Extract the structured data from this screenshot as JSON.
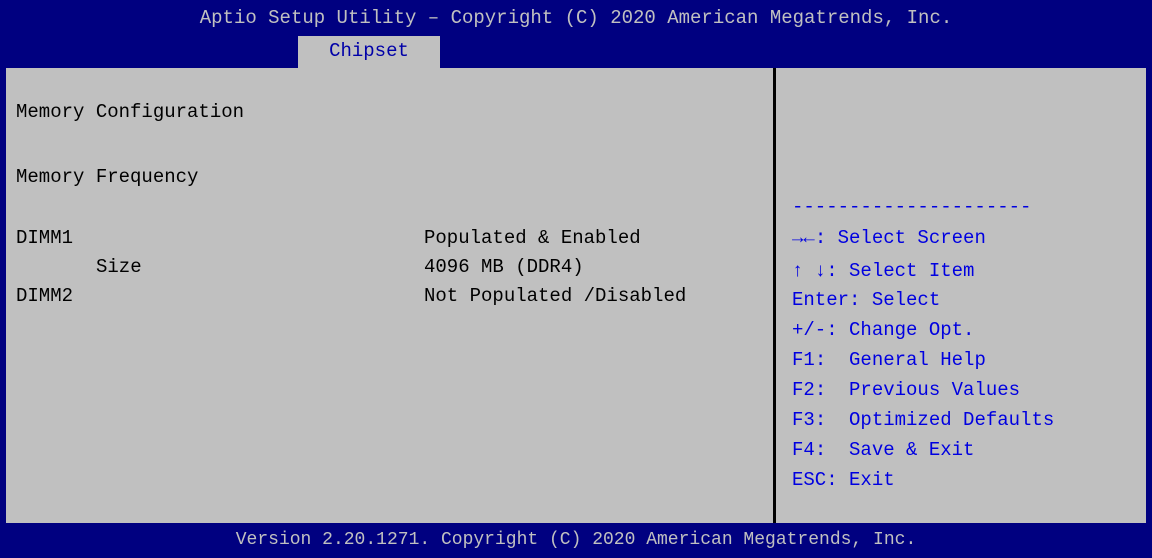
{
  "window": {
    "title": "Aptio Setup Utility – Copyright (C) 2020 American Megatrends, Inc.",
    "active_tab": "Chipset"
  },
  "main": {
    "section_title": "Memory Configuration",
    "memory_frequency_label": "Memory Frequency",
    "rows": [
      {
        "label": "DIMM1",
        "value": "Populated & Enabled"
      },
      {
        "label": "Size",
        "value": "4096 MB (DDR4)"
      },
      {
        "label": "DIMM2",
        "value": "Not Populated /Disabled"
      }
    ]
  },
  "help_panel": {
    "separator": "---------------------",
    "items": [
      {
        "key": "→←",
        "desc": ": Select Screen"
      },
      {
        "key": "↑ ↓",
        "desc": ": Select Item"
      },
      {
        "key": "Enter",
        "desc": ": Select"
      },
      {
        "key": "+/-",
        "desc": ": Change Opt."
      },
      {
        "key": "F1",
        "desc": ":  General Help"
      },
      {
        "key": "F2",
        "desc": ":  Previous Values"
      },
      {
        "key": "F3",
        "desc": ":  Optimized Defaults"
      },
      {
        "key": "F4",
        "desc": ":  Save & Exit"
      },
      {
        "key": "ESC",
        "desc": ": Exit"
      }
    ]
  },
  "footer": {
    "version_text": "Version 2.20.1271. Copyright (C) 2020 American Megatrends, Inc."
  },
  "colors": {
    "background": "#000080",
    "panel": "#c0c0c0",
    "help_text": "#0000e0",
    "title_text": "#c0c0c0"
  }
}
